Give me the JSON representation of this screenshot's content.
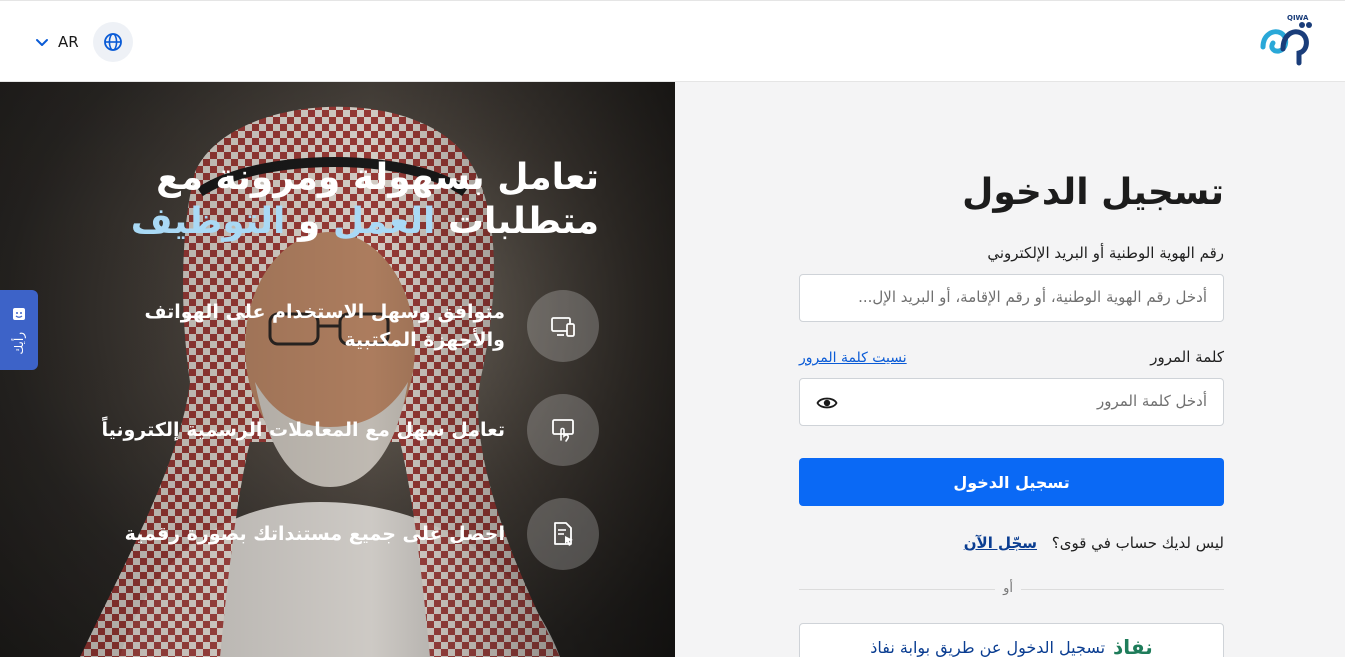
{
  "header": {
    "language": "AR",
    "logo_text": "QIWA",
    "icons": {
      "language": "globe-icon",
      "dropdown": "chevron-down-icon"
    }
  },
  "hero": {
    "title_line1": "تعامل بسهولة ومرونة مع",
    "title_line2_part1": "متطلبات",
    "title_line2_hl1": "العمل",
    "title_line2_and": "و",
    "title_line2_hl2": "التوظيف",
    "features": [
      {
        "text_line1": "متوافق وسهل الاستخدام على الهواتف",
        "text_line2": "والأجهزة المكتبية",
        "icon": "devices-icon"
      },
      {
        "text_line1": "تعامل سهل مع المعاملات الرسمية إلكترونياً",
        "text_line2": "",
        "icon": "monitor-touch-icon"
      },
      {
        "text_line1": "احصل على جميع مستنداتك بصورة رقمية",
        "text_line2": "",
        "icon": "document-cursor-icon"
      }
    ]
  },
  "feedback": {
    "label": "رأيك"
  },
  "login": {
    "title": "تسجيل الدخول",
    "id_label": "رقم الهوية الوطنية أو البريد الإلكتروني",
    "id_placeholder": "أدخل رقم الهوية الوطنية، أو رقم الإقامة، أو البريد الإل...",
    "password_label": "كلمة المرور",
    "forgot_password": "نسيت كلمة المرور",
    "password_placeholder": "أدخل كلمة المرور",
    "submit": "تسجيل الدخول",
    "no_account": "ليس لديك حساب في قوى؟",
    "register_now": "سجّل الآن",
    "or": "أو",
    "nafath_brand": "نفاذ",
    "nafath_login": "تسجيل الدخول عن طريق بوابة نفاذ"
  },
  "colors": {
    "primary": "#0a69f5",
    "link": "#0a3d91",
    "highlight": "#a9d9f5",
    "nafath": "#1e7c5a",
    "logo": "#1a3d7a",
    "logo_accent": "#2aa8d8"
  }
}
